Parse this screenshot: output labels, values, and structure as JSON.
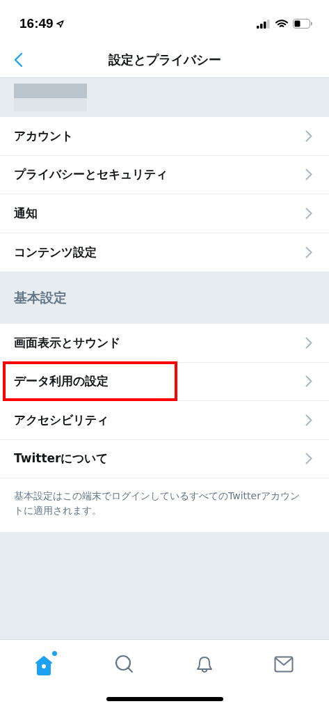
{
  "status_bar": {
    "time": "16:49"
  },
  "nav": {
    "title": "設定とプライバシー"
  },
  "account_items": [
    {
      "label": "アカウント"
    },
    {
      "label": "プライバシーとセキュリティ"
    },
    {
      "label": "通知"
    },
    {
      "label": "コンテンツ設定"
    }
  ],
  "general_section": {
    "title": "基本設定",
    "items": [
      {
        "label": "画面表示とサウンド",
        "highlighted": false
      },
      {
        "label": "データ利用の設定",
        "highlighted": true
      },
      {
        "label": "アクセシビリティ",
        "highlighted": false
      },
      {
        "label": "Twitterについて",
        "highlighted": false
      }
    ],
    "note": "基本設定はこの端末でログインしているすべてのTwitterアカウントに適用されます。"
  },
  "tab_bar": [
    {
      "kind": "home",
      "selected": true,
      "badge": true
    },
    {
      "kind": "search",
      "selected": false,
      "badge": false
    },
    {
      "kind": "notifications",
      "selected": false,
      "badge": false
    },
    {
      "kind": "messages",
      "selected": false,
      "badge": false
    }
  ]
}
